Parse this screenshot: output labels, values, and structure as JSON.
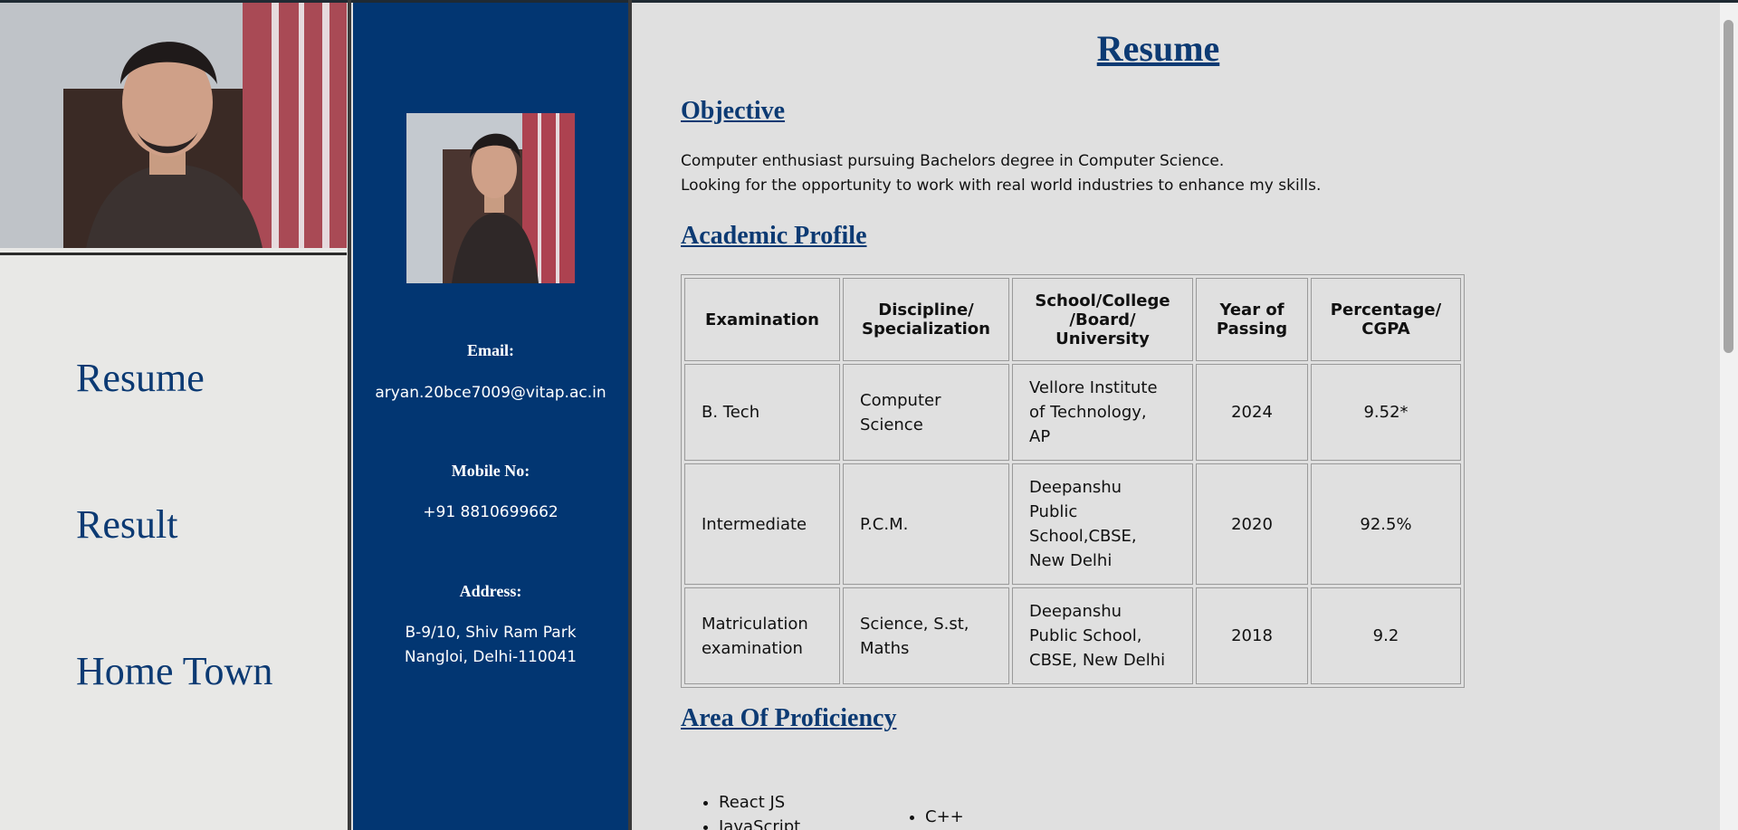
{
  "nav": {
    "items": [
      {
        "label": "Resume"
      },
      {
        "label": "Result"
      },
      {
        "label": "Home Town"
      }
    ]
  },
  "contact": {
    "email_label": "Email:",
    "email_value": "aryan.20bce7009@vitap.ac.in",
    "mobile_label": "Mobile No:",
    "mobile_value": "+91 8810699662",
    "address_label": "Address:",
    "address_line1": "B-9/10, Shiv Ram Park",
    "address_line2": "Nangloi, Delhi-110041"
  },
  "resume": {
    "title": "Resume",
    "objective_heading": "Objective",
    "objective_line1": "Computer enthusiast pursuing Bachelors degree in Computer Science.",
    "objective_line2": "Looking for the opportunity to work with real world industries to enhance my skills.",
    "academic_heading": "Academic Profile",
    "academic_table": {
      "headers": [
        "Examination",
        "Discipline/\nSpecialization",
        "School/College\n/Board/\nUniversity",
        "Year of\nPassing",
        "Percentage/\nCGPA"
      ],
      "rows": [
        [
          "B. Tech",
          "Computer\nScience",
          "Vellore Institute\nof Technology,\nAP",
          "2024",
          "9.52*"
        ],
        [
          "Intermediate",
          "P.C.M.",
          "Deepanshu\nPublic\nSchool,CBSE,\nNew Delhi",
          "2020",
          "92.5%"
        ],
        [
          "Matriculation\nexamination",
          "Science, S.st,\nMaths",
          "Deepanshu\nPublic School,\nCBSE, New Delhi",
          "2018",
          "9.2"
        ]
      ]
    },
    "proficiency_heading": "Area Of Proficiency",
    "skills_col1": [
      "React JS",
      "JavaScript"
    ],
    "skills_col2": [
      "C++"
    ]
  },
  "colors": {
    "accent_navy": "#0c3a73",
    "contact_panel_bg": "#023672",
    "page_bg": "#e0e0e0"
  }
}
